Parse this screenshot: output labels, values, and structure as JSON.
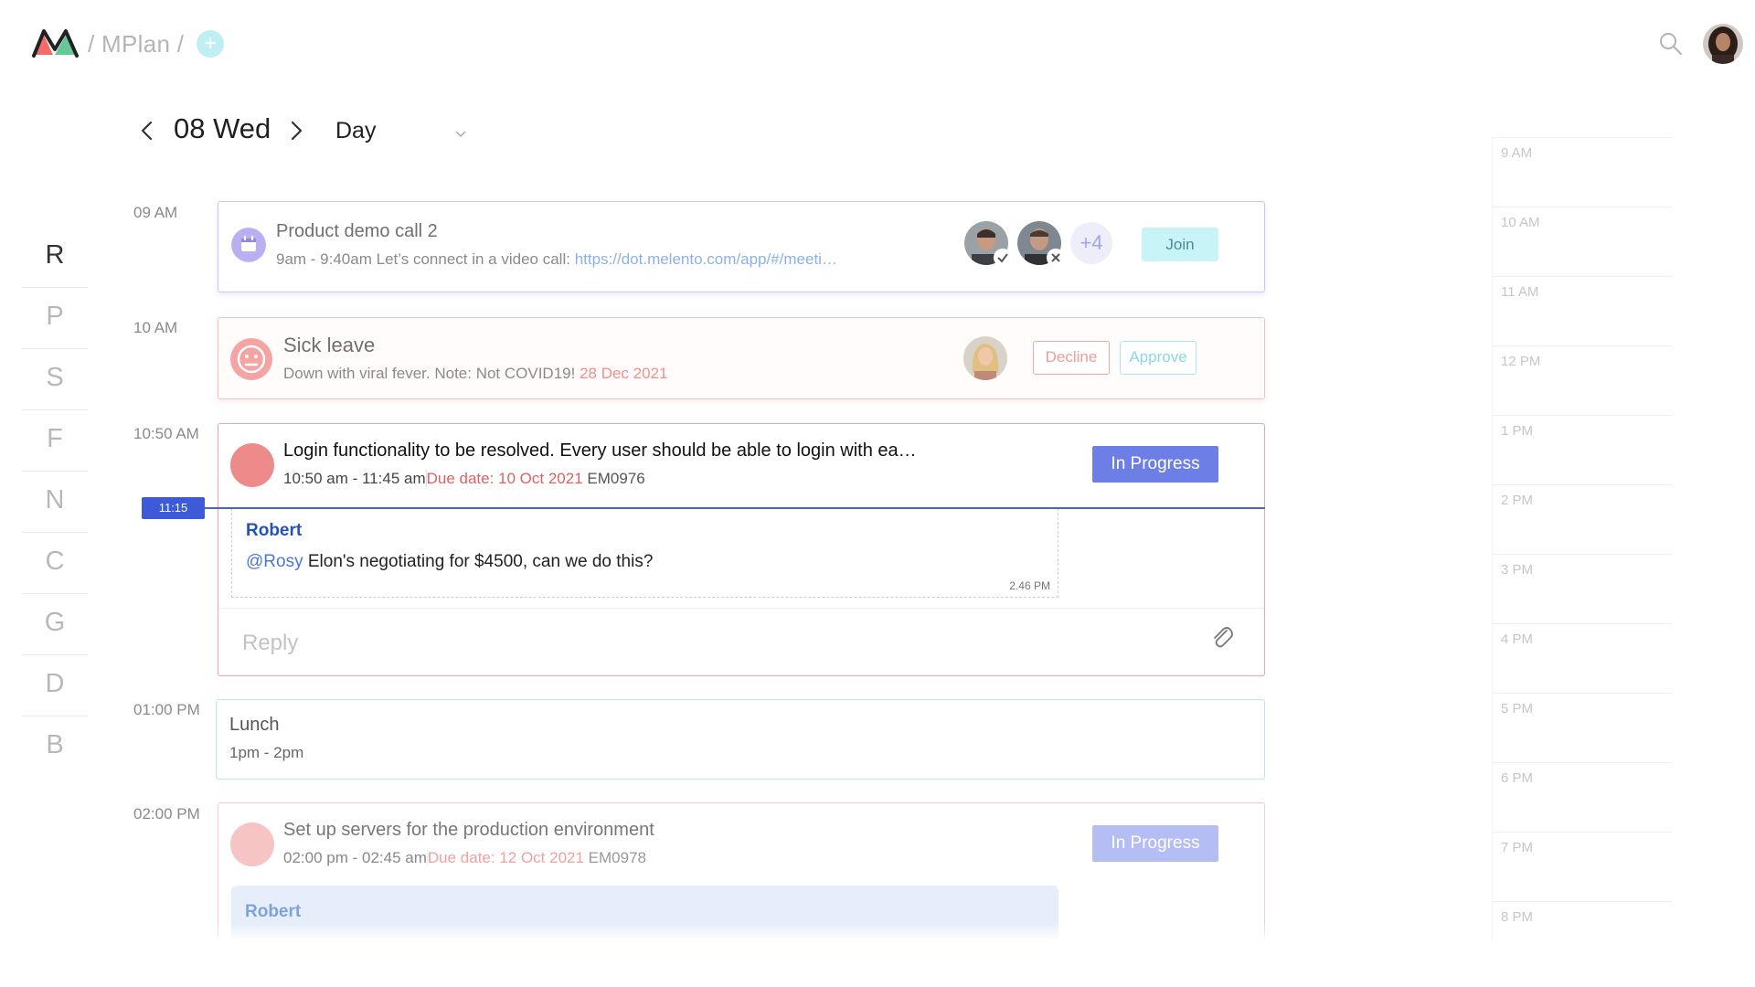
{
  "header": {
    "breadcrumb": "/ MPlan /",
    "add_label": "+"
  },
  "date_nav": {
    "date": "08 Wed",
    "view": "Day"
  },
  "letters": [
    "R",
    "P",
    "S",
    "F",
    "N",
    "C",
    "G",
    "D",
    "B"
  ],
  "times": {
    "t1": "09 AM",
    "t2": "10 AM",
    "t3": "10:50 AM",
    "t4": "01:00 PM",
    "t5": "02:00 PM"
  },
  "now_time": "11:15",
  "events": {
    "demo": {
      "title": "Product demo call 2",
      "time": "9am - 9:40am",
      "desc": "Let’s connect in a video call:",
      "link": "https://dot.melento.com/app/#/meeti…",
      "more": "+4",
      "join": "Join"
    },
    "sick": {
      "title": "Sick leave",
      "desc": "Down with viral fever. Note: Not COVID19!",
      "date": "28 Dec 2021",
      "decline": "Decline",
      "approve": "Approve"
    },
    "login": {
      "title": "Login functionality to be resolved. Every user should be able to login with ea…",
      "time": "10:50 am - 11:45 am",
      "due": "Due date: 10 Oct 2021",
      "code": "EM0976",
      "status": "In Progress",
      "comment_author": "Robert",
      "comment_mention": "@Rosy",
      "comment_text": "Elon's negotiating for $4500, can we do this?",
      "comment_time": "2.46 PM",
      "reply_placeholder": "Reply"
    },
    "lunch": {
      "title": "Lunch",
      "time": "1pm - 2pm"
    },
    "servers": {
      "title": "Set up servers for the production environment",
      "time": "02:00 pm - 02:45 am",
      "due": "Due date: 12 Oct 2021",
      "code": "EM0978",
      "status": "In Progress",
      "comment_author": "Robert"
    }
  },
  "mini_timeline": [
    "9 AM",
    "10 AM",
    "11 AM",
    "12 PM",
    "1 PM",
    "2 PM",
    "3 PM",
    "4 PM",
    "5 PM",
    "6 PM",
    "7 PM",
    "8 PM"
  ],
  "colors": {
    "accent": "#6d7fe6",
    "now_line": "#4a63cf",
    "danger": "#e8625f",
    "cyan": "#c8f3f7"
  }
}
